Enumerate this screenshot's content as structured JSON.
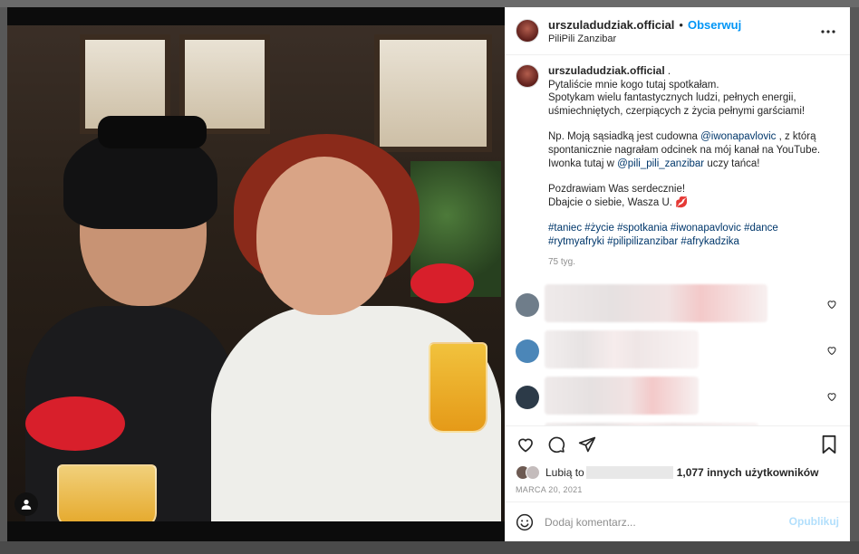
{
  "header": {
    "username": "urszuladudziak.official",
    "separator": "•",
    "follow_label": "Obserwuj",
    "location": "PiliPili Zanzibar"
  },
  "caption": {
    "username": "urszuladudziak.official",
    "trail": " .",
    "line1": "Pytaliście mnie kogo tutaj spotkałam.",
    "line2": "Spotykam wielu fantastycznych ludzi, pełnych energii,",
    "line3": "uśmiechniętych, czerpiących z życia pełnymi garściami!",
    "line4_pre": "Np. Moją sąsiadką jest cudowna ",
    "mention1": "@iwonapavlovic",
    "line4_post": " , z którą",
    "line5": "spontanicznie nagrałam odcinek na mój kanał na YouTube.",
    "line6_pre": "Iwonka tutaj w ",
    "mention2": "@pili_pili_zanzibar",
    "line6_post": " uczy tańca!",
    "line7": "Pozdrawiam Was serdecznie!",
    "line8": "Dbajcie o siebie, Wasza U. 💋",
    "tags_line1": "#taniec #życie #spotkania #iwonapavlovic #dance",
    "tags_line2": "#rytmyafryki #pilipilizanzibar #afrykadzika",
    "time_ago": "75 tyg."
  },
  "comments": [
    {
      "avatar_color": "#6f7d8a"
    },
    {
      "avatar_color": "#4b86b8"
    },
    {
      "avatar_color": "#2c3a48"
    },
    {
      "avatar_color": "#a88a5e"
    }
  ],
  "actions": {
    "like_icon": "heart-icon",
    "comment_icon": "comment-icon",
    "share_icon": "share-icon",
    "save_icon": "bookmark-icon"
  },
  "likes": {
    "prefix": "Lubią to",
    "count_text": "1,077 innych użytkowników"
  },
  "date": "MARCA 20, 2021",
  "add_comment": {
    "placeholder": "Dodaj komentarz...",
    "publish_label": "Opublikuj"
  },
  "colors": {
    "accent": "#0095f6",
    "mention": "#00376b",
    "publish_disabled": "#b2dffc"
  }
}
